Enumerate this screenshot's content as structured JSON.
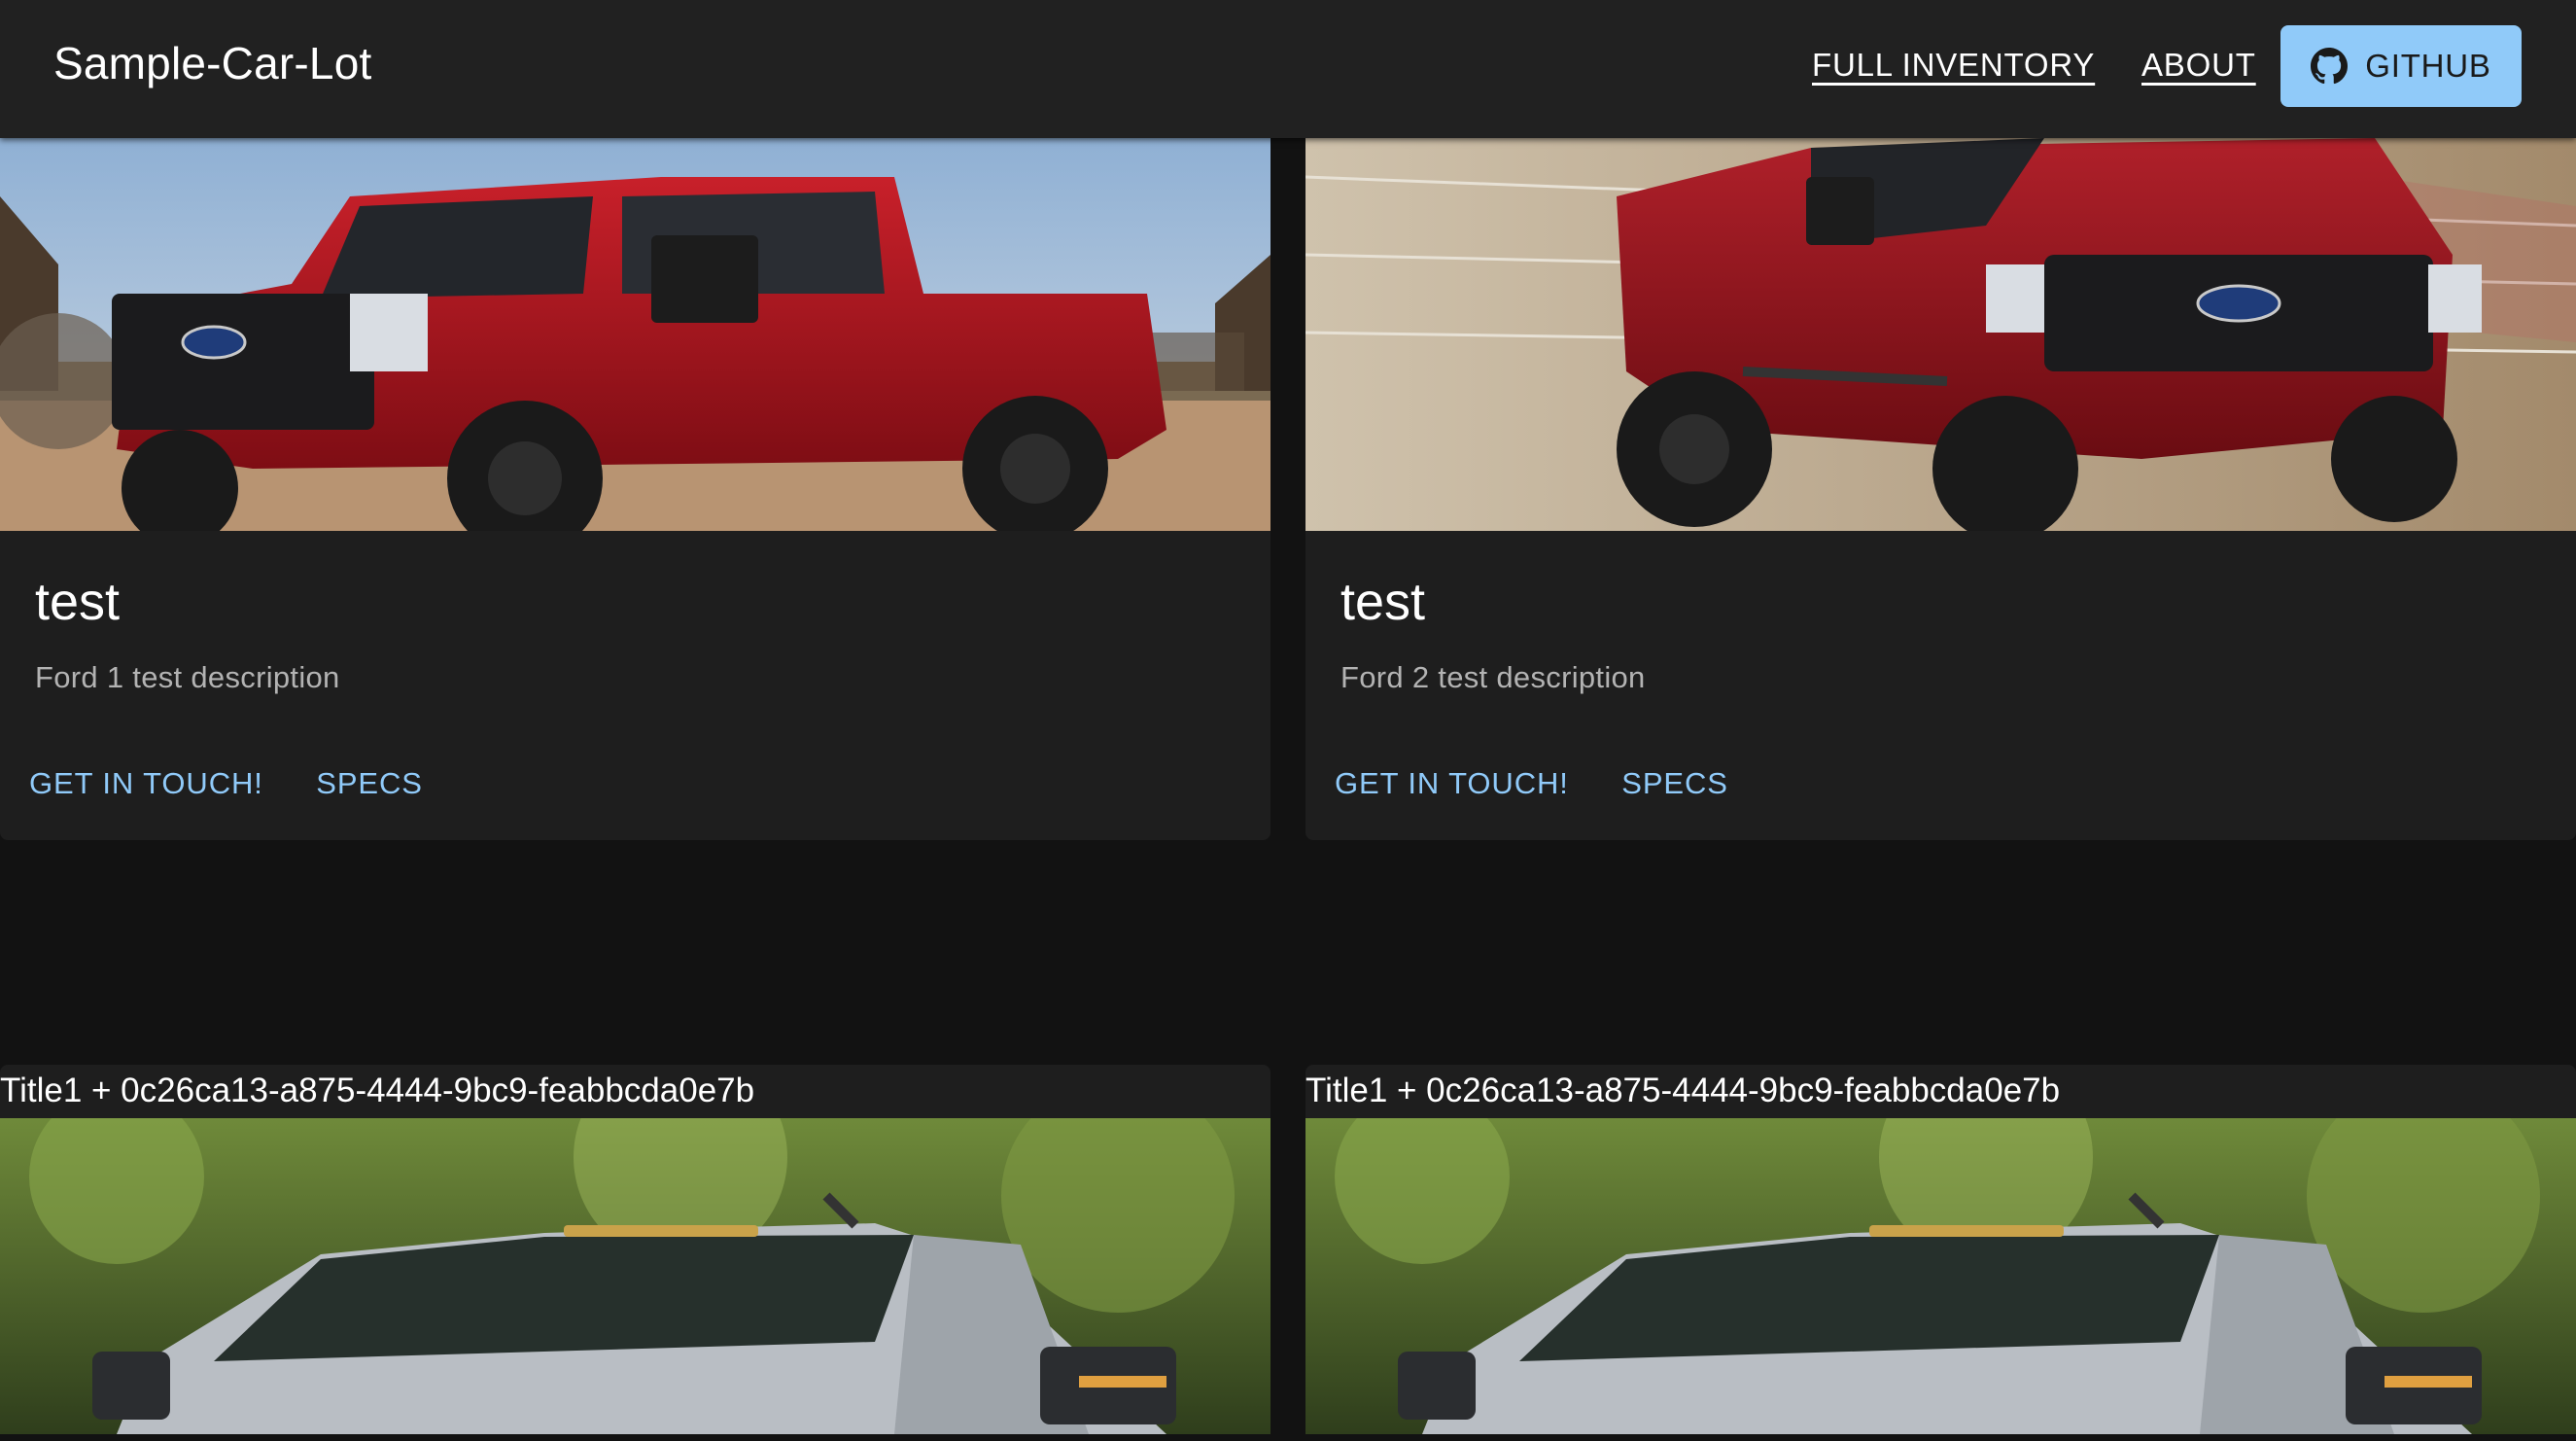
{
  "header": {
    "brand": "Sample-Car-Lot",
    "nav": {
      "full_inventory": "FULL INVENTORY",
      "about": "ABOUT",
      "github": "GITHUB"
    },
    "github_icon": "github-icon"
  },
  "featured": [
    {
      "title": "test",
      "description": "Ford 1 test description",
      "actions": {
        "contact": "GET IN TOUCH!",
        "specs": "SPECS"
      }
    },
    {
      "title": "test",
      "description": "Ford 2 test description",
      "actions": {
        "contact": "GET IN TOUCH!",
        "specs": "SPECS"
      }
    }
  ],
  "listings": [
    {
      "title": "Title1 + 0c26ca13-a875-4444-9bc9-feabbcda0e7b"
    },
    {
      "title": "Title1 + 0c26ca13-a875-4444-9bc9-feabbcda0e7b"
    }
  ],
  "colors": {
    "background": "#121212",
    "surface": "#1e1e1e",
    "appbar": "#212121",
    "primary": "#90caf9",
    "truck_red": "#a8141c"
  }
}
